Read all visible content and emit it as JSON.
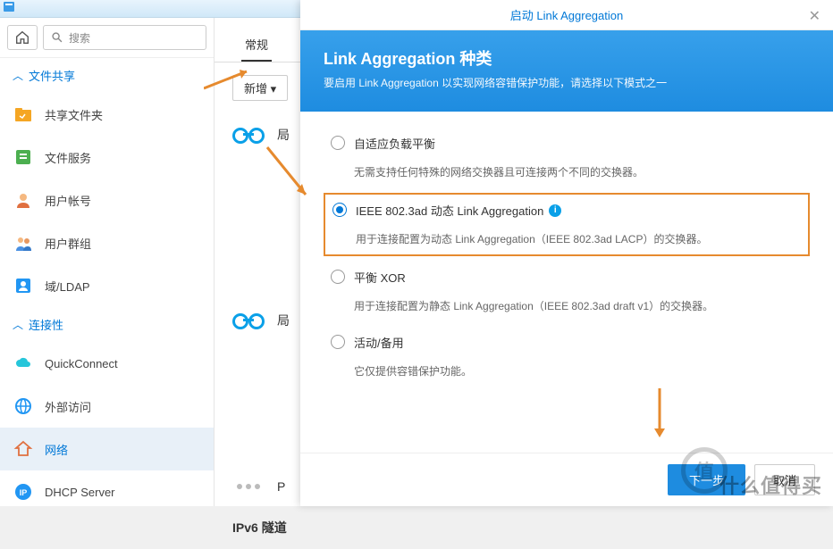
{
  "topbar": {},
  "search": {
    "placeholder": "搜索"
  },
  "sections": {
    "fileshare": {
      "label": "文件共享"
    },
    "connectivity": {
      "label": "连接性"
    }
  },
  "sidebar": {
    "items": [
      {
        "label": "共享文件夹"
      },
      {
        "label": "文件服务"
      },
      {
        "label": "用户帐号"
      },
      {
        "label": "用户群组"
      },
      {
        "label": "域/LDAP"
      },
      {
        "label": "QuickConnect"
      },
      {
        "label": "外部访问"
      },
      {
        "label": "网络"
      },
      {
        "label": "DHCP Server"
      }
    ]
  },
  "content": {
    "tab_general": "常规",
    "btn_new": "新增 ▾",
    "item_lan1": "局",
    "item_lan2": "局",
    "item_ppp": "P",
    "item_ipv6": "IPv6 隧道"
  },
  "modal": {
    "title": "启动 Link Aggregation",
    "heading": "Link Aggregation 种类",
    "subheading": "要启用 Link Aggregation 以实现网络容错保护功能，请选择以下模式之一",
    "options": [
      {
        "label": "自适应负载平衡",
        "desc": "无需支持任何特殊的网络交换器且可连接两个不同的交换器。"
      },
      {
        "label": "IEEE 802.3ad 动态 Link Aggregation",
        "desc": "用于连接配置为动态 Link Aggregation（IEEE 802.3ad LACP）的交换器。"
      },
      {
        "label": "平衡 XOR",
        "desc": "用于连接配置为静态 Link Aggregation（IEEE 802.3ad draft v1）的交换器。"
      },
      {
        "label": "活动/备用",
        "desc": "它仅提供容错保护功能。"
      }
    ],
    "btn_next": "下一步",
    "btn_cancel": "取消"
  },
  "watermark": "什么值得买",
  "wm_badge": "值"
}
